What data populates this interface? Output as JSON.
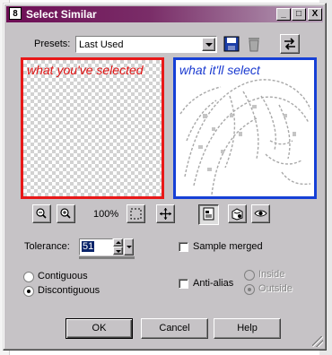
{
  "window": {
    "title": "Select Similar",
    "controls": {
      "minimize": "_",
      "maximize": "□",
      "close": "X"
    }
  },
  "presets": {
    "label": "Presets:",
    "value": "Last Used",
    "buttons": [
      "save-icon",
      "delete-icon",
      "reset-icon"
    ]
  },
  "preview": {
    "left_caption": "what you've selected",
    "right_caption": "what it'll select"
  },
  "toolbar": {
    "zoom_out": "zoom-out-icon",
    "zoom_in": "zoom-in-icon",
    "zoom_level": "100%",
    "marquee": "marquee-icon",
    "pan": "pan-icon",
    "proof": "proof-icon",
    "auto_proof": "auto-proof-icon",
    "preview_toggle": "eye-icon"
  },
  "tolerance": {
    "label": "Tolerance:",
    "value": "51"
  },
  "options": {
    "sample_merged": {
      "label": "Sample merged",
      "checked": false
    },
    "contiguous": {
      "label": "Contiguous",
      "selected": false
    },
    "discontiguous": {
      "label": "Discontiguous",
      "selected": true
    },
    "anti_alias": {
      "label": "Anti-alias",
      "checked": false
    },
    "inside": {
      "label": "Inside",
      "enabled": false
    },
    "outside": {
      "label": "Outside",
      "enabled": false,
      "selected": true
    }
  },
  "buttons": {
    "ok": "OK",
    "cancel": "Cancel",
    "help": "Help"
  }
}
